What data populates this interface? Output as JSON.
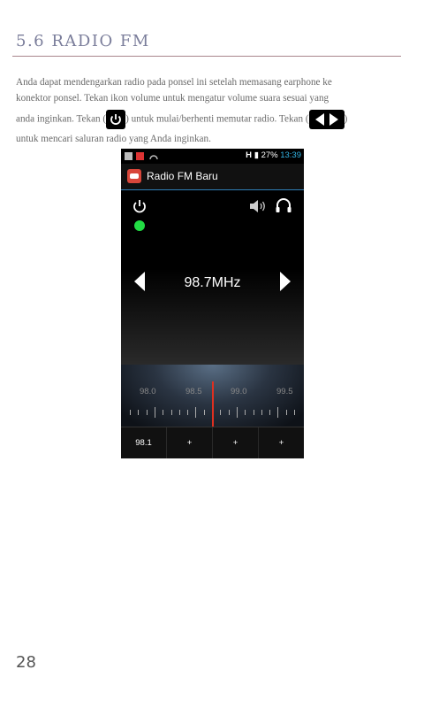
{
  "section_title": "5.6 RADIO FM",
  "paragraph": {
    "line1": "Anda dapat mendengarkan radio pada ponsel ini setelah memasang earphone ke",
    "line2": "konektor ponsel. Tekan ikon volume untuk mengatur volume suara sesuai yang",
    "line3a": "anda inginkan. Tekan (",
    "line3b": ") untuk mulai/berhenti memutar radio. Tekan (",
    "line3c": ")",
    "line4": "untuk mencari saluran radio yang Anda inginkan."
  },
  "icons": {
    "power": "power-icon",
    "arrows": "left-right-arrows-icon"
  },
  "phone": {
    "status_bar": {
      "battery": "27%",
      "time": "13:39",
      "network": "H"
    },
    "app_title": "Radio FM Baru",
    "frequency": "98.7MHz",
    "dial_labels": [
      "98.0",
      "98.5",
      "99.0",
      "99.5"
    ],
    "presets": [
      "98.1",
      "+",
      "+",
      "+"
    ]
  },
  "page_number": "28"
}
